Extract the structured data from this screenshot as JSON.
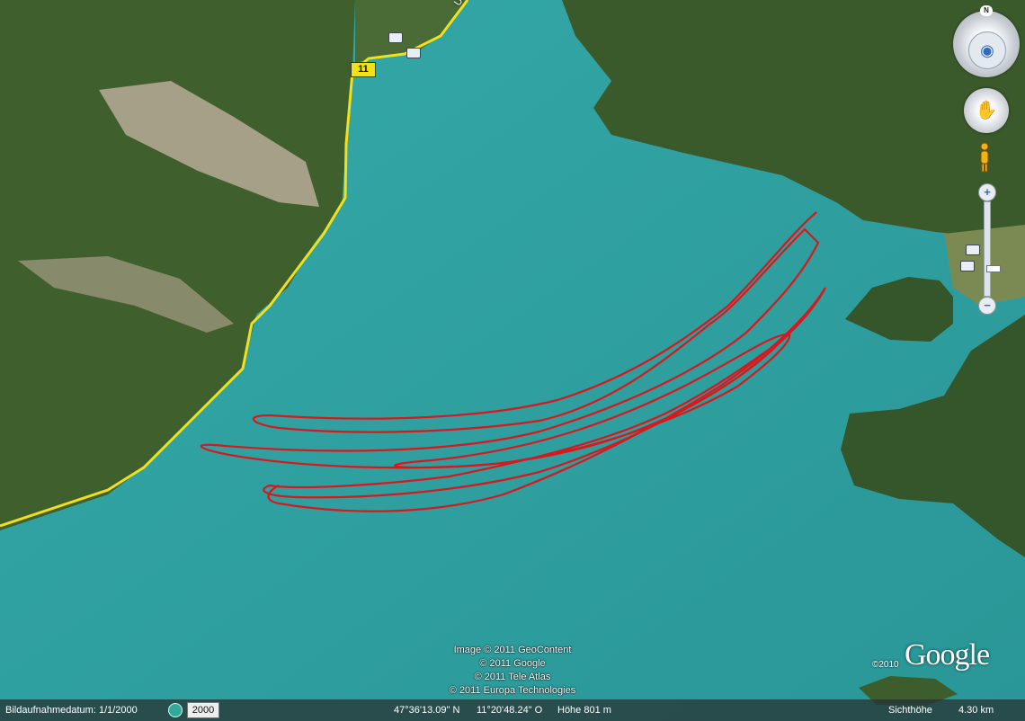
{
  "map": {
    "road_number": "11",
    "road_name": "Ur",
    "colors": {
      "water": "#2e9fa0",
      "forest": "#3d5e2c",
      "track": "#d8181c",
      "road": "#f1e01a"
    }
  },
  "credits": [
    "Image © 2011 GeoContent",
    "© 2011 Google",
    "© 2011 Tele Atlas",
    "© 2011 Europa Technologies"
  ],
  "logo": {
    "text": "Google",
    "year": "©2010"
  },
  "nav": {
    "compass_label": "N",
    "look_icon": "eye-icon",
    "move_icon": "hand-icon",
    "pegman_icon": "pegman-icon",
    "zoom_in": "+",
    "zoom_out": "−"
  },
  "statusbar": {
    "imagery_date": "Bildaufnahmedatum: 1/1/2000",
    "year_button": "2000",
    "latitude": "47°36'13.09\" N",
    "longitude": "11°20'48.24\" O",
    "elevation": "Höhe  801 m",
    "eye_alt_label": "Sichthöhe",
    "eye_alt_value": "4.30 km"
  }
}
